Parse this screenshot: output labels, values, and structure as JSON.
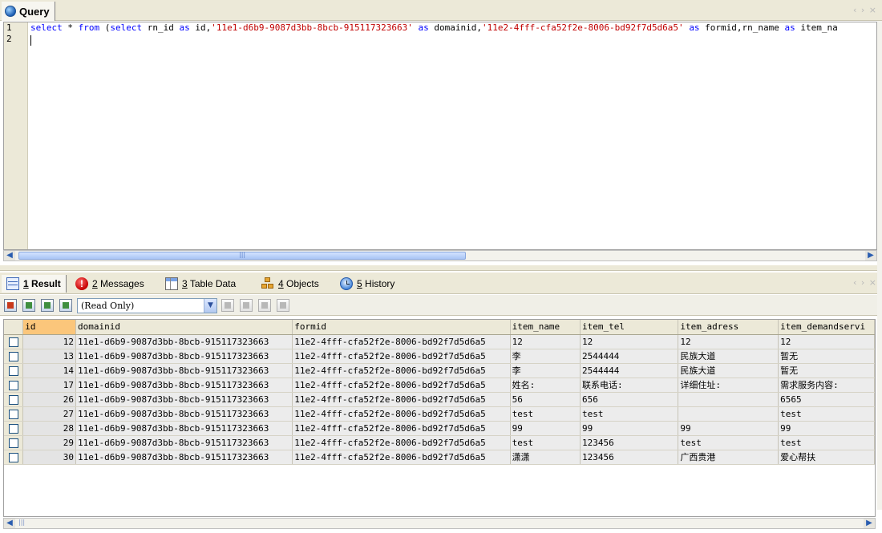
{
  "query_tab": {
    "label": "Query",
    "nav": "‹ › ×"
  },
  "editor": {
    "line_numbers": [
      "1",
      "2"
    ],
    "sql_line": [
      {
        "t": "kw",
        "v": "select"
      },
      {
        "t": "plain",
        "v": " * "
      },
      {
        "t": "kw",
        "v": "from"
      },
      {
        "t": "plain",
        "v": " ("
      },
      {
        "t": "kw",
        "v": "select"
      },
      {
        "t": "plain",
        "v": " rn_id "
      },
      {
        "t": "kw",
        "v": "as"
      },
      {
        "t": "plain",
        "v": " id,"
      },
      {
        "t": "str",
        "v": "'11e1-d6b9-9087d3bb-8bcb-915117323663'"
      },
      {
        "t": "plain",
        "v": " "
      },
      {
        "t": "kw",
        "v": "as"
      },
      {
        "t": "plain",
        "v": " domainid,"
      },
      {
        "t": "str",
        "v": "'11e2-4fff-cfa52f2e-8006-bd92f7d5d6a5'"
      },
      {
        "t": "plain",
        "v": " "
      },
      {
        "t": "kw",
        "v": "as"
      },
      {
        "t": "plain",
        "v": " formid,rn_name "
      },
      {
        "t": "kw",
        "v": "as"
      },
      {
        "t": "plain",
        "v": " item_na"
      }
    ]
  },
  "result_tabs": [
    {
      "num": "1",
      "label": "Result",
      "icon": "grid-icon"
    },
    {
      "num": "2",
      "label": "Messages",
      "icon": "error-icon"
    },
    {
      "num": "3",
      "label": "Table Data",
      "icon": "table-icon"
    },
    {
      "num": "4",
      "label": "Objects",
      "icon": "objects-icon"
    },
    {
      "num": "5",
      "label": "History",
      "icon": "history-icon"
    }
  ],
  "toolbar": {
    "mode": "(Read Only)"
  },
  "grid": {
    "columns": [
      "id",
      "domainid",
      "formid",
      "item_name",
      "item_tel",
      "item_adress",
      "item_demandservi"
    ],
    "rows": [
      [
        "12",
        "11e1-d6b9-9087d3bb-8bcb-915117323663",
        "11e2-4fff-cfa52f2e-8006-bd92f7d5d6a5",
        "12",
        "12",
        "12",
        "12"
      ],
      [
        "13",
        "11e1-d6b9-9087d3bb-8bcb-915117323663",
        "11e2-4fff-cfa52f2e-8006-bd92f7d5d6a5",
        "李",
        "2544444",
        "民族大道",
        "暂无"
      ],
      [
        "14",
        "11e1-d6b9-9087d3bb-8bcb-915117323663",
        "11e2-4fff-cfa52f2e-8006-bd92f7d5d6a5",
        "李",
        "2544444",
        "民族大道",
        "暂无"
      ],
      [
        "17",
        "11e1-d6b9-9087d3bb-8bcb-915117323663",
        "11e2-4fff-cfa52f2e-8006-bd92f7d5d6a5",
        "姓名:",
        "联系电话:",
        "详细住址:",
        "需求服务内容:"
      ],
      [
        "26",
        "11e1-d6b9-9087d3bb-8bcb-915117323663",
        "11e2-4fff-cfa52f2e-8006-bd92f7d5d6a5",
        "56",
        "656",
        "",
        "6565"
      ],
      [
        "27",
        "11e1-d6b9-9087d3bb-8bcb-915117323663",
        "11e2-4fff-cfa52f2e-8006-bd92f7d5d6a5",
        "test",
        "test",
        "",
        "test"
      ],
      [
        "28",
        "11e1-d6b9-9087d3bb-8bcb-915117323663",
        "11e2-4fff-cfa52f2e-8006-bd92f7d5d6a5",
        "99",
        "99",
        "99",
        "99"
      ],
      [
        "29",
        "11e1-d6b9-9087d3bb-8bcb-915117323663",
        "11e2-4fff-cfa52f2e-8006-bd92f7d5d6a5",
        "test",
        "123456",
        "test",
        "test"
      ],
      [
        "30",
        "11e1-d6b9-9087d3bb-8bcb-915117323663",
        "11e2-4fff-cfa52f2e-8006-bd92f7d5d6a5",
        "潇潇",
        "123456",
        "广西贵港",
        "爱心帮扶"
      ]
    ]
  },
  "colors": {
    "keyword": "#0000ff",
    "string": "#c00000",
    "header_highlight": "#fbc67b"
  }
}
